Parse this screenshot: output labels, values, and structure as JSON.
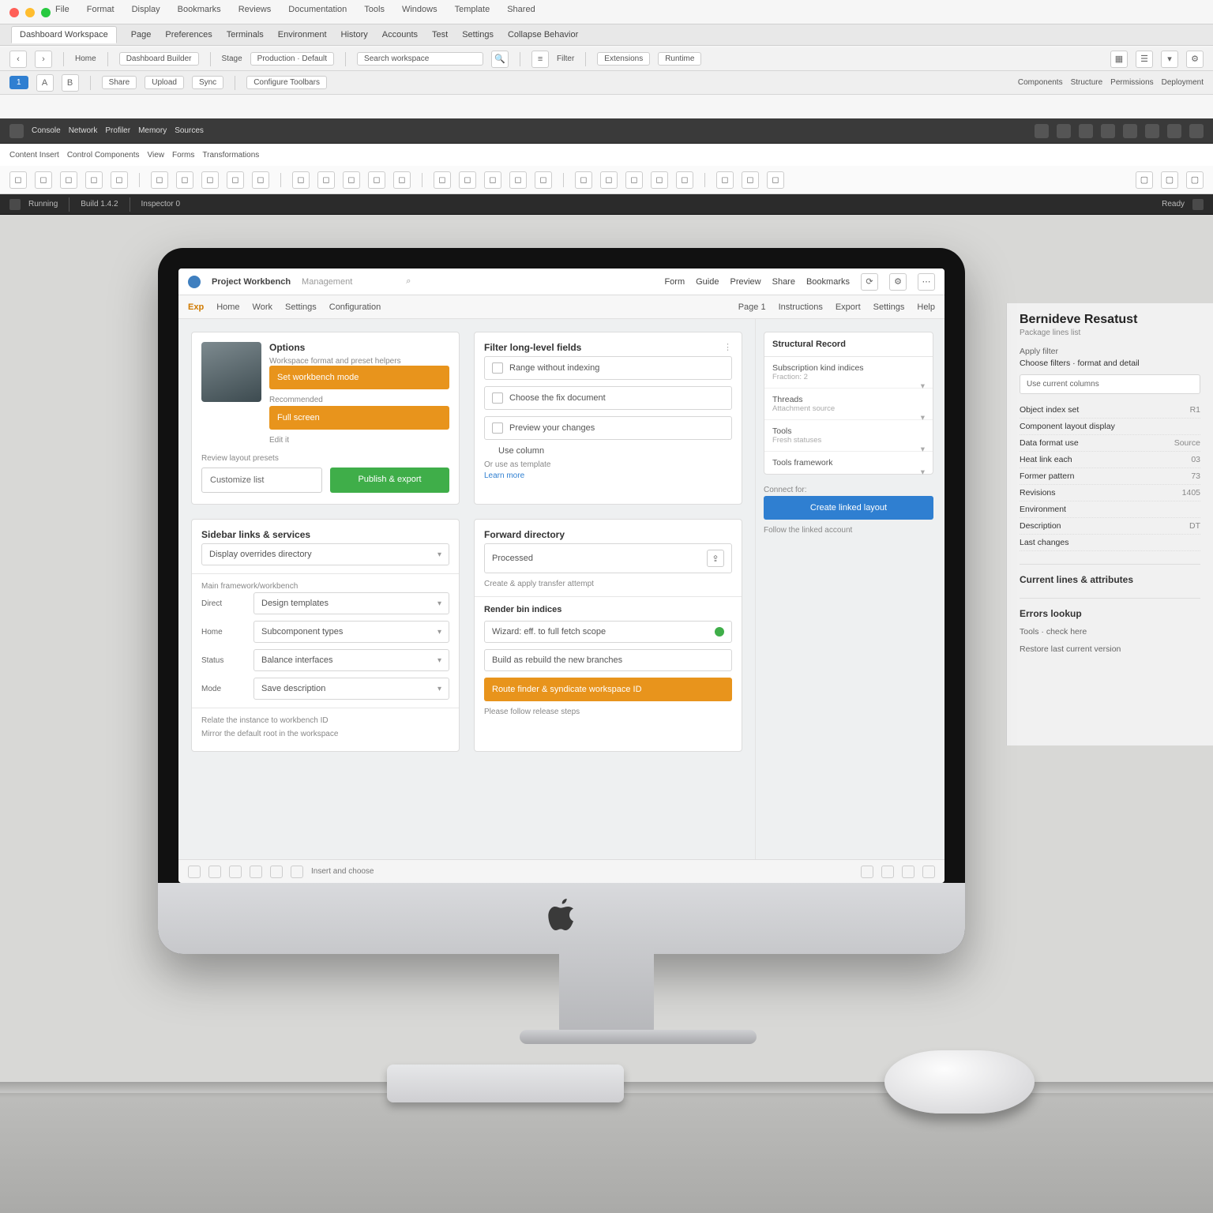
{
  "outer": {
    "menus": [
      "File",
      "Format",
      "Display",
      "Bookmarks",
      "Reviews",
      "Documentation",
      "Tools",
      "Windows",
      "Template",
      "Shared"
    ],
    "tabs": {
      "active": "Dashboard Workspace",
      "others": [
        "Page",
        "Preferences",
        "Terminals",
        "Environment",
        "History",
        "Accounts",
        "Test",
        "Settings",
        "Collapse Behavior"
      ]
    },
    "toolbar1": {
      "home": "Home",
      "project": "Dashboard Builder",
      "env": "Stage",
      "envpick": "Production · Default",
      "search": "Search workspace",
      "filter": "Filter",
      "ext1": "Extensions",
      "ext2": "Runtime"
    },
    "toolbar2": {
      "one": "1",
      "a": "A",
      "b": "B",
      "items": [
        "Share",
        "Upload",
        "Sync"
      ],
      "btn": "Configure Toolbars",
      "chips": [
        "Components",
        "Structure",
        "Permissions",
        "Deployment"
      ]
    },
    "dark": {
      "items": [
        "Console",
        "Network",
        "Profiler",
        "Memory",
        "Sources"
      ]
    },
    "ribbon_tabs": [
      "Content Insert",
      "Control Components",
      "View",
      "Forms",
      "Transformations"
    ],
    "ribbon_btns_count": 28,
    "dark2": {
      "left": [
        "●",
        "Running",
        "Build 1.4.2",
        "Inspector 0"
      ],
      "right": [
        "Ready"
      ]
    }
  },
  "inner": {
    "brand": "Project Workbench",
    "brand_sub": "Management",
    "tabs": [
      "Form",
      "Guide",
      "Preview",
      "Share",
      "Bookmarks"
    ],
    "tabs_help": "Help",
    "subbar": {
      "tag": "Exp",
      "crumbs": [
        "Home",
        "Work",
        "Settings",
        "Configuration"
      ],
      "right": [
        "Page 1",
        "Instructions",
        "Export",
        "Settings"
      ]
    },
    "cardA": {
      "title": "Options",
      "sub": "Workspace format and preset helpers",
      "btn1": "Set workbench mode",
      "lbl1": "Recommended",
      "btn2": "Full screen",
      "lbl2": "Edit it",
      "lbl3": "Review layout presets",
      "btn_outline": "Customize list",
      "btn_green": "Publish & export"
    },
    "cardB": {
      "title": "Filter long-level fields",
      "sub": "",
      "in1": "Range without indexing",
      "in2": "Choose the fix document",
      "in3": "Preview your changes",
      "chk": "Use column",
      "note": "Or use as template",
      "link": "Learn more"
    },
    "cardC": {
      "title": "Sidebar links & services",
      "in": "Display overrides directory",
      "sub": "Main framework/workbench",
      "rows": [
        {
          "l": "Direct",
          "v": "Design templates"
        },
        {
          "l": "Home",
          "v": "Subcomponent types"
        },
        {
          "l": "Status",
          "v": "Balance interfaces"
        },
        {
          "l": "Mode",
          "v": "Save description"
        }
      ],
      "foot1": "Relate the instance to workbench ID",
      "foot2": "Mirror the default root in the workspace"
    },
    "cardD": {
      "title": "Forward directory",
      "in": "Processed",
      "sub": "Create & apply transfer attempt",
      "sect": "Render bin indices",
      "row1": "Wizard: eff. to full fetch scope",
      "row2": "Build as rebuild the new branches",
      "btn": "Route finder & syndicate workspace ID",
      "foot": "Please follow release steps"
    },
    "side": {
      "title": "Structural Record",
      "items": [
        {
          "t": "Subscription kind indices",
          "s": "Fraction: 2"
        },
        {
          "t": "Threads",
          "s": "Attachment source"
        },
        {
          "t": "Tools",
          "s": "Fresh statuses"
        },
        {
          "t": "Tools framework",
          "s": ""
        }
      ],
      "note": "Connect for:",
      "btn": "Create linked layout",
      "foot": "Follow the linked account"
    },
    "status": {
      "left_icons": 6,
      "text": "Insert and choose",
      "right_icons": 4
    }
  },
  "inspector": {
    "title": "Bernideve Resatust",
    "sub": "Package lines list",
    "lab1": "Apply filter",
    "chip": "Choose filters · format and detail",
    "box": "Use current columns",
    "kv": [
      {
        "k": "Object index set",
        "v": "R1"
      },
      {
        "k": "Component layout display",
        "v": ""
      },
      {
        "k": "Data format use",
        "v": "Source"
      },
      {
        "k": "Heat link each",
        "v": "03"
      },
      {
        "k": "Former pattern",
        "v": "73"
      },
      {
        "k": "Revisions",
        "v": "1405"
      },
      {
        "k": "Environment",
        "v": ""
      },
      {
        "k": "Description",
        "v": "DT"
      },
      {
        "k": "Last changes",
        "v": ""
      }
    ],
    "hdr2": "Current  lines & attributes",
    "hdr3": "Errors lookup",
    "foot1": "Tools · check here",
    "foot2": "Restore last  current version"
  }
}
